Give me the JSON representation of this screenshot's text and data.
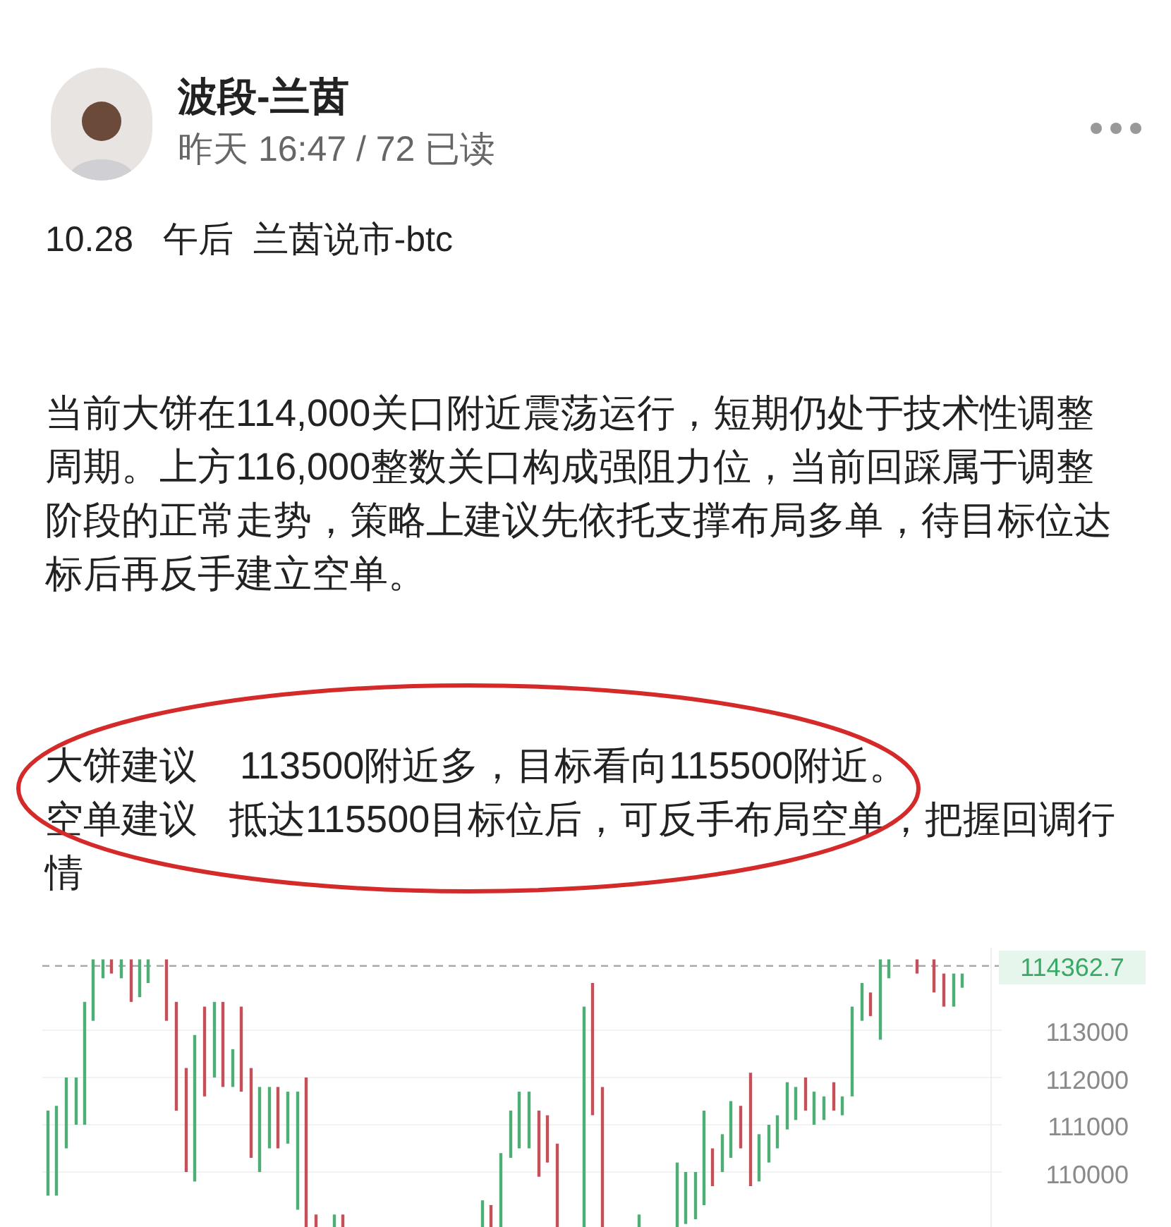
{
  "author": {
    "name": "波段-兰茵",
    "meta": "昨天 16:47 / 72 已读"
  },
  "post": {
    "title": "10.28   午后  兰茵说市-btc",
    "paragraph": "当前大饼在114,000关口附近震荡运行，短期仍处于技术性调整周期。上方116,000整数关口构成强阻力位，当前回踩属于调整阶段的正常走势，策略上建议先依托支撑布局多单，待目标位达标后再反手建立空单。",
    "suggestions": [
      "大饼建议    113500附近多，目标看向115500附近。",
      "空单建议   抵达115500目标位后，可反手布局空单，把握回调行情"
    ]
  },
  "chart": {
    "price_tag": "114362.7",
    "axis_labels": [
      "113000",
      "112000",
      "111000",
      "110000"
    ]
  }
}
